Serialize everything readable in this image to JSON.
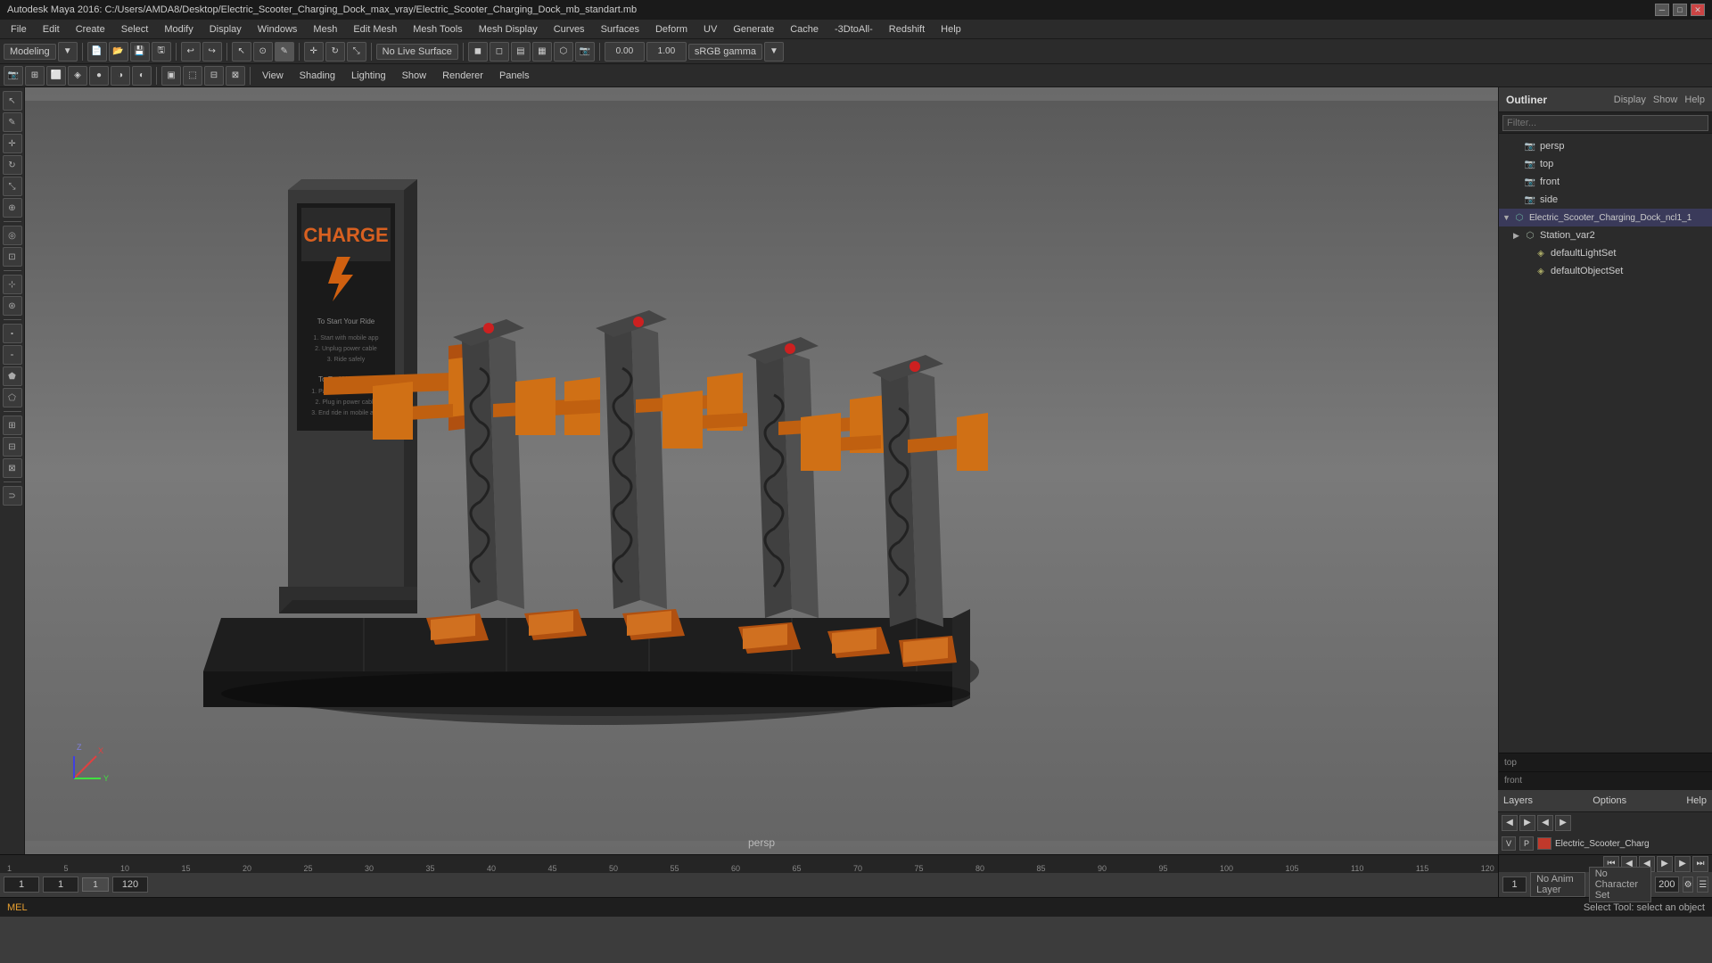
{
  "titlebar": {
    "title": "Autodesk Maya 2016: C:/Users/AMDA8/Desktop/Electric_Scooter_Charging_Dock_max_vray/Electric_Scooter_Charging_Dock_mb_standart.mb",
    "controls": [
      "─",
      "□",
      "✕"
    ]
  },
  "menubar": {
    "items": [
      "File",
      "Edit",
      "Create",
      "Select",
      "Modify",
      "Display",
      "Windows",
      "Mesh",
      "Edit Mesh",
      "Mesh Tools",
      "Mesh Display",
      "Curves",
      "Surfaces",
      "Deform",
      "UV",
      "Generate",
      "Cache",
      "3DtoAll",
      "Redshift",
      "Help"
    ]
  },
  "toolbar1": {
    "mode_label": "Modeling",
    "live_surface": "No Live Surface",
    "gamma_label": "sRGB gamma",
    "value1": "0.00",
    "value2": "1.00"
  },
  "toolbar2": {
    "items": [
      "View",
      "Shading",
      "Lighting",
      "Show",
      "Renderer",
      "Panels"
    ]
  },
  "viewport": {
    "label": "persp",
    "background_top": "#6e6e6e",
    "background_bottom": "#8a8a8a"
  },
  "outliner": {
    "title": "Outliner",
    "menu": [
      "Display",
      "Show",
      "Help"
    ],
    "tree": [
      {
        "id": "persp",
        "label": "persp",
        "type": "camera",
        "indent": 0
      },
      {
        "id": "top",
        "label": "top",
        "type": "camera",
        "indent": 0
      },
      {
        "id": "front",
        "label": "front",
        "type": "camera",
        "indent": 0
      },
      {
        "id": "side",
        "label": "side",
        "type": "camera",
        "indent": 0
      },
      {
        "id": "dock",
        "label": "Electric_Scooter_Charging_Dock_ncl1_1",
        "type": "mesh",
        "indent": 0,
        "expanded": true
      },
      {
        "id": "station",
        "label": "Station_var2",
        "type": "group",
        "indent": 1
      },
      {
        "id": "lightset",
        "label": "defaultLightSet",
        "type": "set",
        "indent": 2
      },
      {
        "id": "objset",
        "label": "defaultObjectSet",
        "type": "set",
        "indent": 2
      }
    ]
  },
  "mini_viewports": {
    "top_label": "top",
    "front_label": "front"
  },
  "layers": {
    "title": "Layers",
    "options_label": "Options",
    "help_label": "Help",
    "row": {
      "v": "V",
      "p": "P",
      "color": "#c0392b",
      "name": "Electric_Scooter_Charg"
    }
  },
  "timeline": {
    "ticks": [
      1,
      5,
      10,
      15,
      20,
      25,
      30,
      35,
      40,
      45,
      50,
      55,
      60,
      65,
      70,
      75,
      80,
      85,
      90,
      95,
      100,
      105,
      110,
      115,
      120
    ],
    "current_frame": "1",
    "start_frame": "1",
    "end_frame": "120",
    "range_start": "1",
    "range_end": "200",
    "playback_btns": [
      "⏮",
      "◀◀",
      "◀",
      "▶",
      "▶▶",
      "⏭"
    ]
  },
  "anim": {
    "no_anim_layer": "No Anim Layer",
    "no_char_set": "No Character Set"
  },
  "cmdline": {
    "type": "MEL",
    "status": "Select Tool: select an object"
  },
  "scene": {
    "model_color": "#e07020",
    "base_color": "#2a2a2a",
    "pole_color": "#555555"
  }
}
